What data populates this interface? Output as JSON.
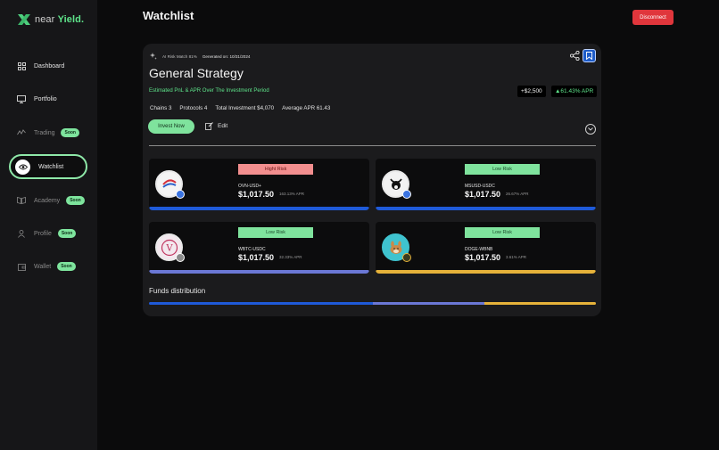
{
  "brand": {
    "prefix": "near",
    "suffix": "Yield."
  },
  "sidebar": {
    "items": [
      {
        "label": "Dashboard",
        "icon": "grid-icon",
        "badge": ""
      },
      {
        "label": "Portfolio",
        "icon": "monitor-icon",
        "badge": ""
      },
      {
        "label": "Trading",
        "icon": "trading-icon",
        "badge": "Soon"
      },
      {
        "label": "Watchlist",
        "icon": "eye-icon",
        "badge": ""
      },
      {
        "label": "Academy",
        "icon": "book-icon",
        "badge": "Soon"
      },
      {
        "label": "Profile",
        "icon": "user-icon",
        "badge": "Soon"
      },
      {
        "label": "Wallet",
        "icon": "wallet-icon",
        "badge": "Soon"
      }
    ]
  },
  "header": {
    "title": "Watchlist",
    "disconnect_label": "Disconnect"
  },
  "card": {
    "risk_match": "AI Risk Match 81%",
    "generated_label": "Generated on: 10/31/2024",
    "title": "General Strategy",
    "pnl_caption": "Estimated PnL & APR Over The Investment Period",
    "pnl_value": "+$2,500",
    "apr_value": "▲61.43% APR",
    "stats": {
      "chains": "Chains 3",
      "protocols": "Protocols 4",
      "investment": "Total Investment $4,070",
      "avg_apr": "Average APR 61.43"
    },
    "invest_label": "Invest Now",
    "edit_label": "Edit",
    "pools": [
      {
        "risk": "Hight Risk",
        "pair": "OVN-USD+",
        "amount": "$1,017.50",
        "apr": "163.13% APR",
        "bar_color": "#1f5ad8"
      },
      {
        "risk": "Low Risk",
        "pair": "MSUSD-USDC",
        "amount": "$1,017.50",
        "apr": "26.67% APR",
        "bar_color": "#1f5ad8"
      },
      {
        "risk": "Low Risk",
        "pair": "WBTC-USDC",
        "amount": "$1,017.50",
        "apr": "32.33% APR",
        "bar_color": "#6b78d6"
      },
      {
        "risk": "Low Risk",
        "pair": "DOGE-WBNB",
        "amount": "$1,017.50",
        "apr": "3.61% APR",
        "bar_color": "#e6b23a"
      }
    ],
    "funds_label": "Funds distribution",
    "funds": [
      {
        "share": 0.5,
        "color": "#1f5ad8"
      },
      {
        "share": 0.25,
        "color": "#6b78d6"
      },
      {
        "share": 0.25,
        "color": "#e6b23a"
      }
    ]
  },
  "colors": {
    "accent_green": "#5ee38a",
    "danger": "#e0363c",
    "high_risk_bg": "#f08a8a",
    "low_risk_bg": "#7fe39d"
  }
}
